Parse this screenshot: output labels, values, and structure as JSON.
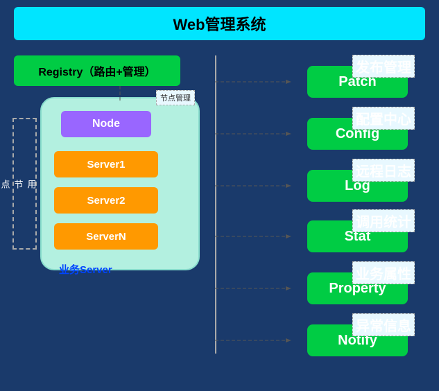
{
  "title": "Web管理系统",
  "registry": {
    "label": "Registry（路由+管理）"
  },
  "appNode": {
    "label": "应用节点"
  },
  "nodeGroup": {
    "nodeLabel": "Node",
    "nodeManagement": "节点管理",
    "servers": [
      "Server1",
      "Server2",
      "ServerN"
    ],
    "businessServer": "业务Server"
  },
  "services": [
    {
      "name": "Patch",
      "tag": "发布管理"
    },
    {
      "name": "Config",
      "tag": "配置中心"
    },
    {
      "name": "Log",
      "tag": "远程日志"
    },
    {
      "name": "Stat",
      "tag": "调用统计"
    },
    {
      "name": "Property",
      "tag": "业务属性"
    },
    {
      "name": "Notify",
      "tag": "异常信息"
    }
  ]
}
